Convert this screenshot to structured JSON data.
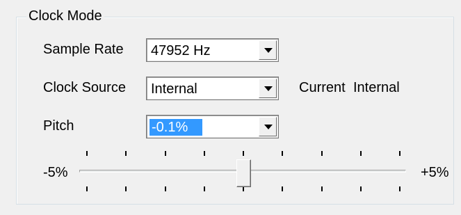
{
  "group": {
    "title": "Clock Mode"
  },
  "sample_rate": {
    "label": "Sample Rate",
    "value": "47952 Hz"
  },
  "clock_source": {
    "label": "Clock Source",
    "value": "Internal",
    "current_label": "Current",
    "current_value": "Internal"
  },
  "pitch": {
    "label": "Pitch",
    "value": "-0.1%"
  },
  "slider": {
    "min_label": "-5%",
    "max_label": "+5%",
    "position_fraction": 0.5,
    "tick_count": 9
  }
}
